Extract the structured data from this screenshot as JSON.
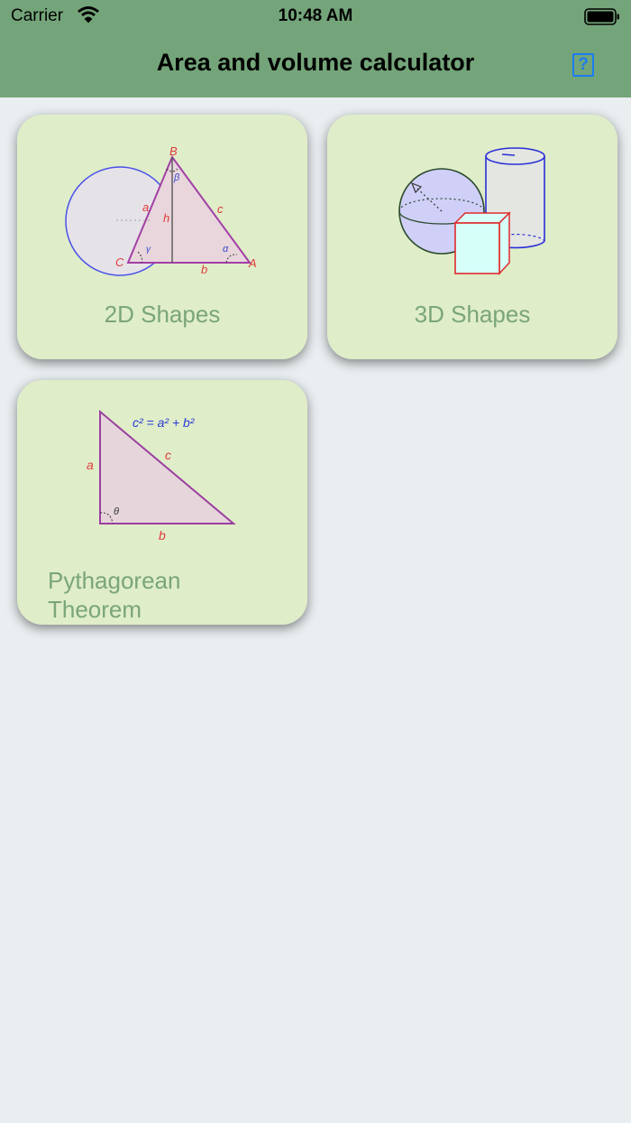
{
  "status_bar": {
    "carrier": "Carrier",
    "time": "10:48 AM"
  },
  "header": {
    "title": "Area and volume calculator",
    "help_label": "?"
  },
  "cards": [
    {
      "label": "2D Shapes",
      "figure_labels": {
        "B": "B",
        "beta": "β",
        "a": "a",
        "h": "h",
        "c": "c",
        "C": "C",
        "gamma": "γ",
        "alpha": "α",
        "A": "A",
        "b": "b"
      }
    },
    {
      "label": "3D Shapes"
    },
    {
      "label_line1": "Pythagorean",
      "label_line2": "Theorem",
      "figure_labels": {
        "a": "a",
        "b": "b",
        "c": "c",
        "theta": "θ"
      }
    }
  ],
  "colors": {
    "header": "#74a57a",
    "background": "#e9eef0",
    "card": "#dfedc9",
    "card_text": "#7aa57a",
    "help": "#1a7cf0"
  }
}
